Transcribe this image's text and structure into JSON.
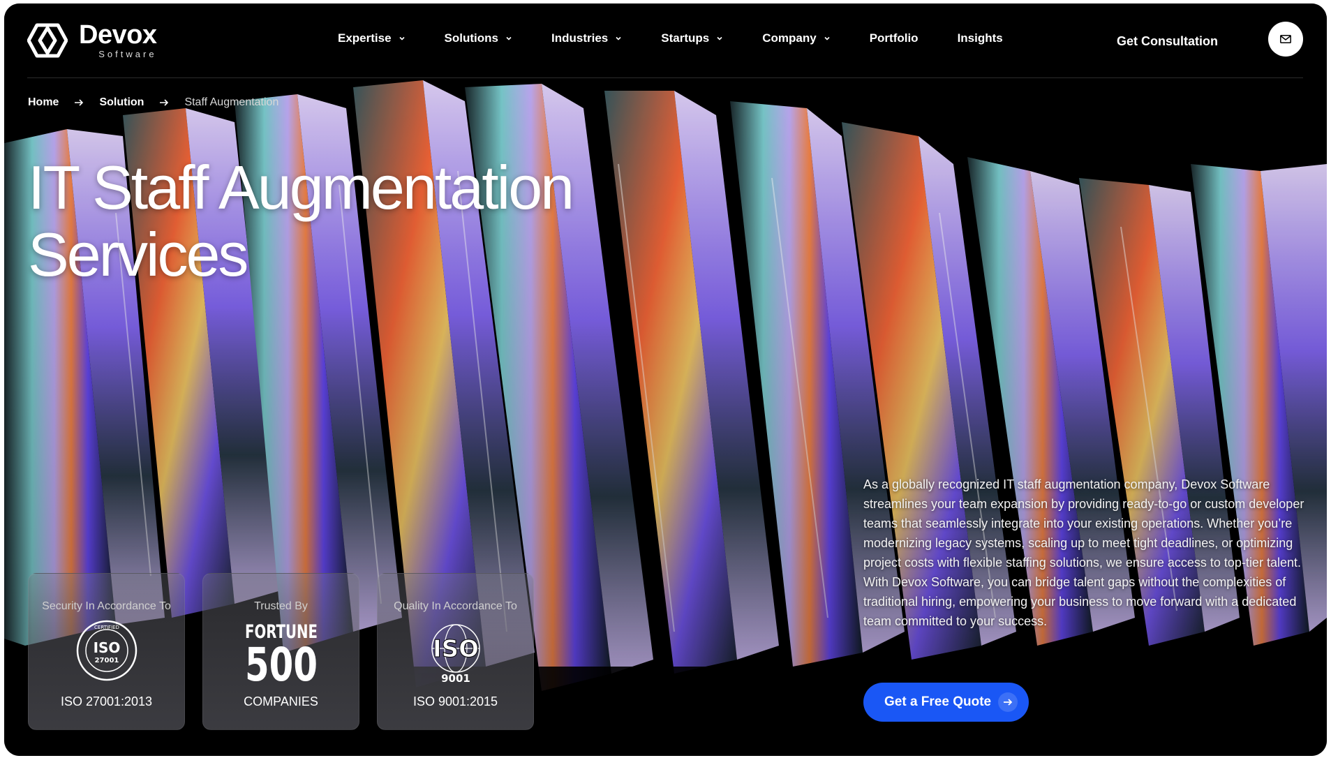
{
  "brand": {
    "name": "Devox",
    "sub": "Software"
  },
  "nav": {
    "items": [
      {
        "label": "Expertise",
        "dropdown": true
      },
      {
        "label": "Solutions",
        "dropdown": true
      },
      {
        "label": "Industries",
        "dropdown": true
      },
      {
        "label": "Startups",
        "dropdown": true
      },
      {
        "label": "Company",
        "dropdown": true
      },
      {
        "label": "Portfolio",
        "dropdown": false
      },
      {
        "label": "Insights",
        "dropdown": false
      }
    ],
    "cta": "Get Consultation",
    "mail_icon": "mail-icon"
  },
  "breadcrumb": [
    "Home",
    "Solution",
    "Staff Augmentation"
  ],
  "hero": {
    "title_line1": "IT Staff Augmentation",
    "title_line2": "Services",
    "description": "As a globally recognized IT staff augmentation company, Devox Software streamlines your team expansion by providing ready-to-go or custom developer teams that seamlessly integrate into your existing operations. Whether you’re modernizing legacy systems, scaling up to meet tight deadlines, or optimizing project costs with flexible staffing solutions, we ensure access to top-tier talent. With Devox Software, you can bridge talent gaps without the complexities of traditional hiring, empowering your business to move forward with a dedicated team committed to your success.",
    "quote_button": "Get a Free Quote"
  },
  "certs": [
    {
      "top": "Security In Accordance To",
      "seal_main": "ISO",
      "seal_num": "27001",
      "seal_ring": "CERTIFIED",
      "bottom": "ISO 27001:2013"
    },
    {
      "top": "Trusted By",
      "logo_line1": "FORTUNE",
      "logo_line2": "500",
      "bottom": "COMPANIES"
    },
    {
      "top": "Quality In Accordance To",
      "logo_main": "ISO",
      "logo_num": "9001",
      "bottom": "ISO 9001:2015"
    }
  ],
  "colors": {
    "accent": "#1a57f5",
    "background": "#000000",
    "text": "#ffffff"
  }
}
